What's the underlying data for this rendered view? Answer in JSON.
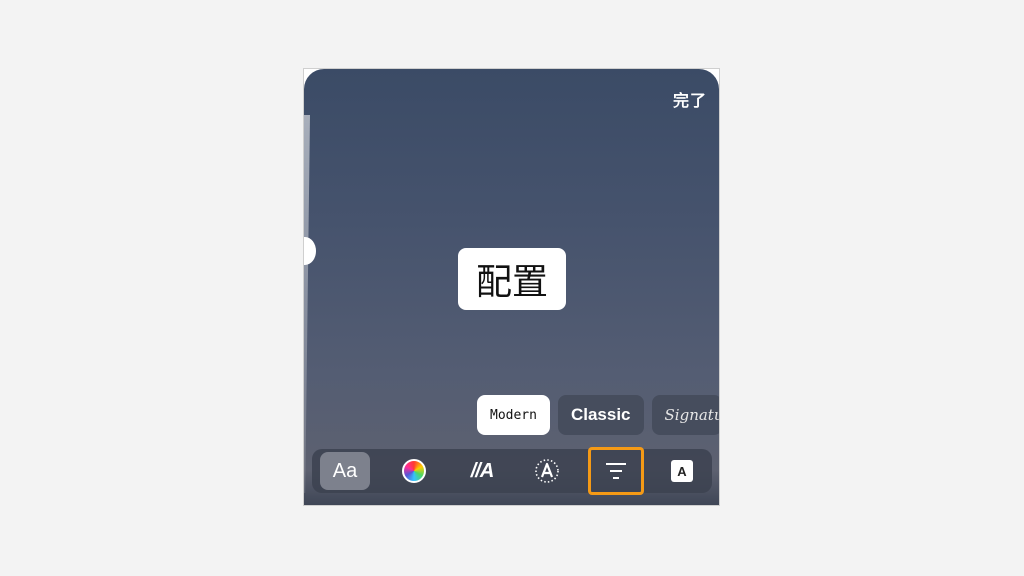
{
  "header": {
    "done_label": "完了"
  },
  "canvas": {
    "text_content": "配置"
  },
  "font_options": [
    {
      "label": "Modern",
      "selected": true
    },
    {
      "label": "Classic",
      "selected": false
    },
    {
      "label": "Signatu",
      "selected": false
    }
  ],
  "toolbar": {
    "font_button_label": "Aa",
    "animation_button_label": "//A",
    "background_button_label": "A",
    "highlighted_tool": "text-align",
    "highlight_color": "#f59a16",
    "icons": [
      "font-style-icon",
      "color-wheel-icon",
      "animation-icon",
      "text-effect-icon",
      "text-align-icon",
      "text-background-icon"
    ]
  }
}
